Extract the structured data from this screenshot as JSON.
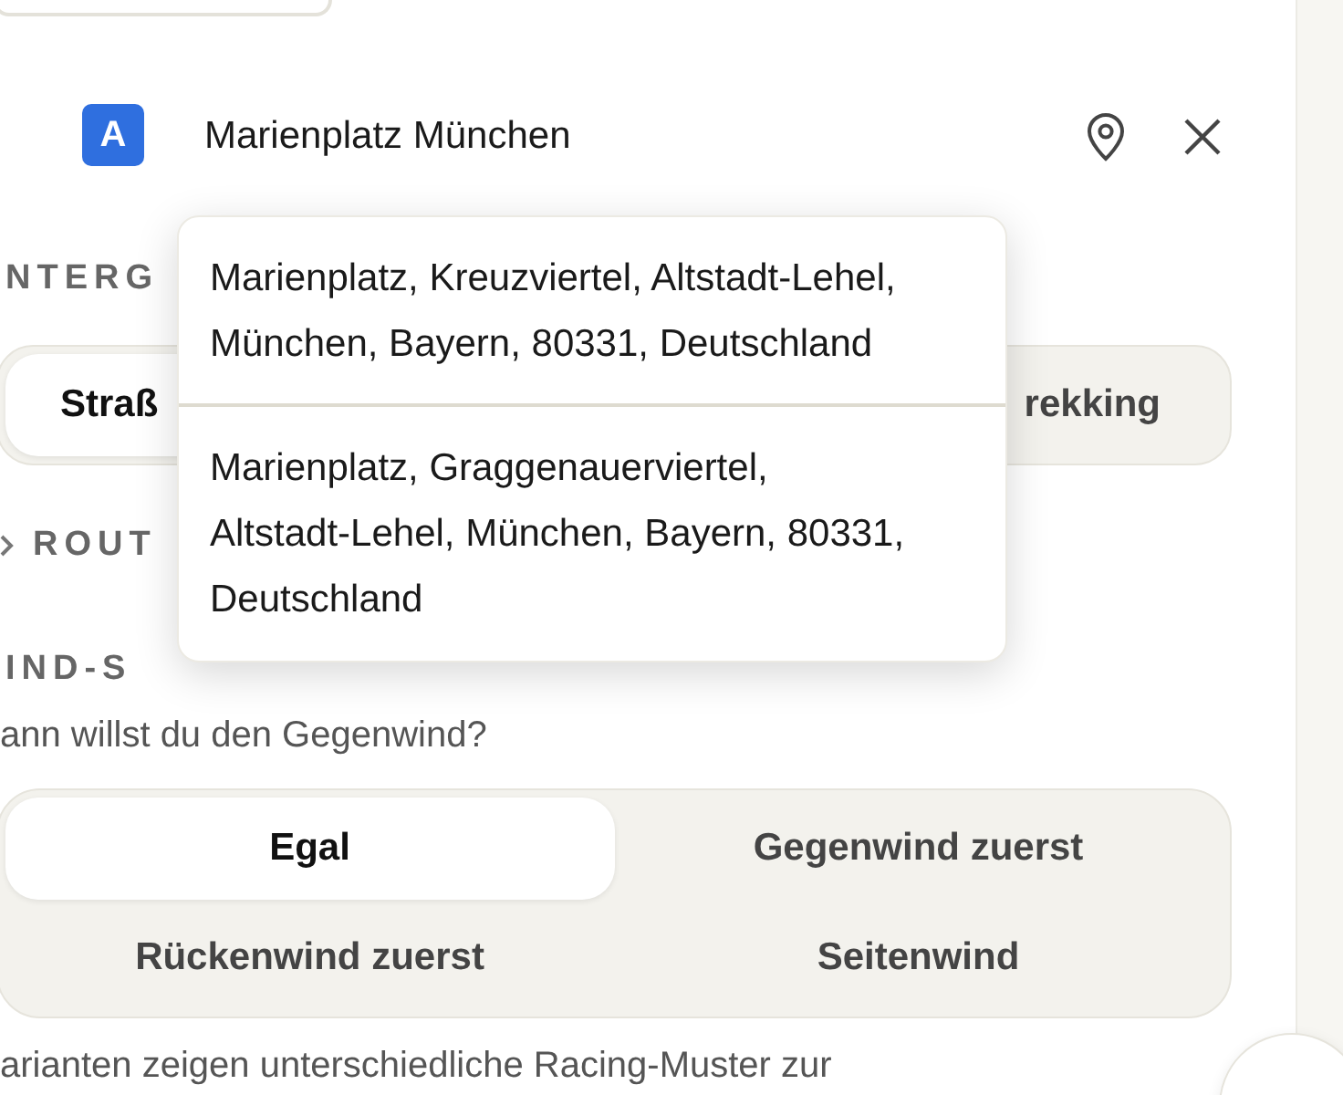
{
  "location": {
    "badge": "A",
    "value": "Marienplatz München"
  },
  "suggestions": [
    {
      "text": "Marienplatz, Kreuzviertel, Altstadt-Lehel, München, Bayern, 80331, Deutschland"
    },
    {
      "text": "Marienplatz, Graggenauerviertel, Altstadt-Lehel, München, Bayern, 80331, Deutschland"
    }
  ],
  "surface": {
    "heading": "NTERG",
    "options": [
      {
        "label": "Straß",
        "selected": true
      },
      {
        "label": "rekking",
        "selected": false
      }
    ]
  },
  "route": {
    "heading": "ROUT"
  },
  "wind": {
    "heading": "IND-S",
    "question": "ann willst du den Gegenwind?",
    "options": [
      {
        "label": "Egal",
        "selected": true
      },
      {
        "label": "Gegenwind zuerst",
        "selected": false
      },
      {
        "label": "Rückenwind zuerst",
        "selected": false
      },
      {
        "label": "Seitenwind",
        "selected": false
      }
    ]
  },
  "footnote": "arianten zeigen unterschiedliche Racing-Muster zur"
}
